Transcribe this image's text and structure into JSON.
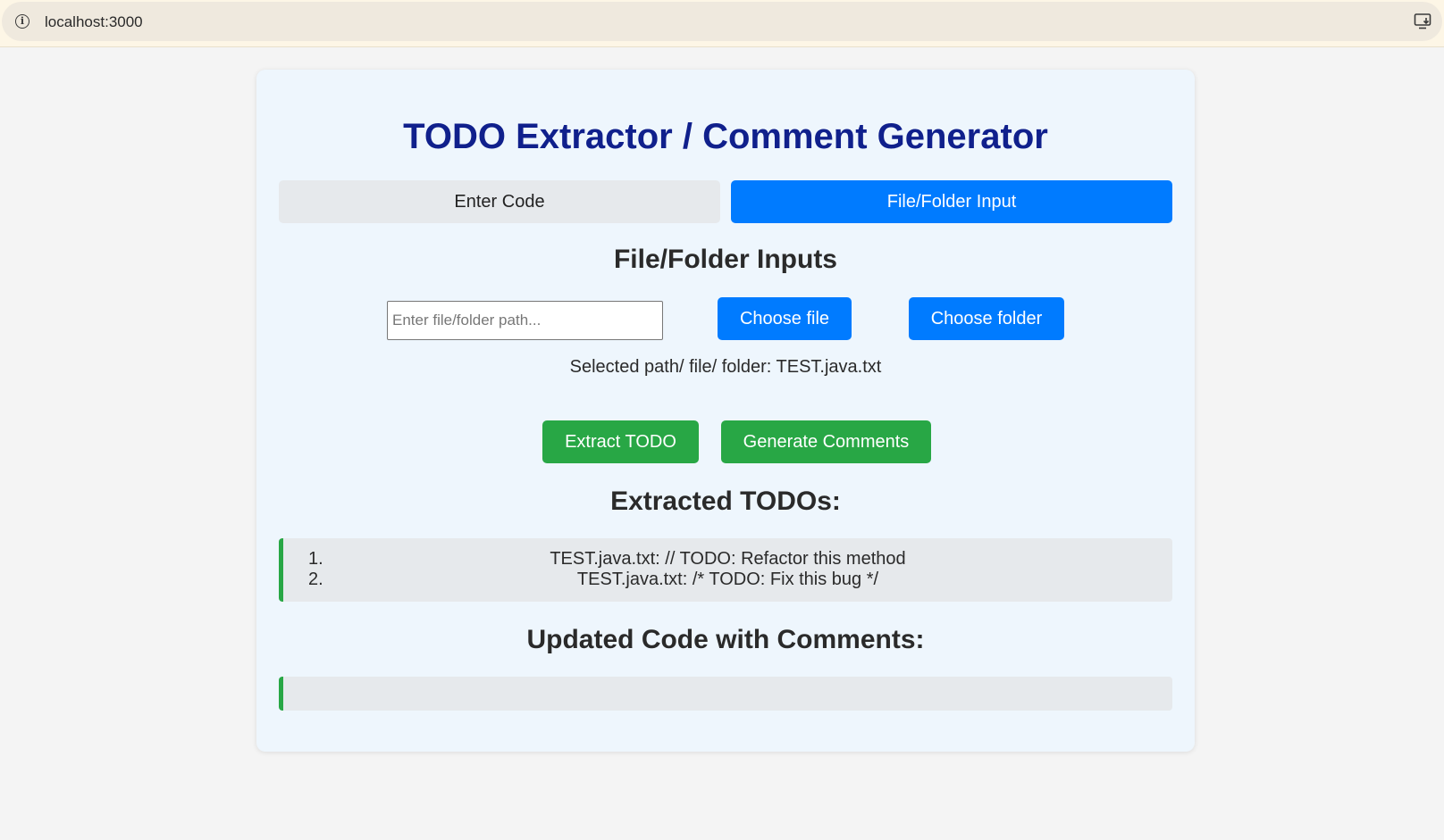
{
  "browser": {
    "url": "localhost:3000"
  },
  "app": {
    "title": "TODO Extractor / Comment Generator",
    "tabs": {
      "enter_code": "Enter Code",
      "file_folder": "File/Folder Input"
    },
    "file_section": {
      "heading": "File/Folder Inputs",
      "path_placeholder": "Enter file/folder path...",
      "path_value": "",
      "choose_file": "Choose file",
      "choose_folder": "Choose folder",
      "selected_path": "Selected path/ file/ folder: TEST.java.txt"
    },
    "actions": {
      "extract": "Extract TODO",
      "generate": "Generate Comments"
    },
    "todos": {
      "heading": "Extracted TODOs:",
      "items": [
        {
          "num": "1.",
          "text": "TEST.java.txt: // TODO: Refactor this method"
        },
        {
          "num": "2.",
          "text": "TEST.java.txt: /* TODO: Fix this bug */"
        }
      ]
    },
    "updated": {
      "heading": "Updated Code with Comments:",
      "content": ""
    }
  },
  "colors": {
    "title": "#10208c",
    "primary": "#007bff",
    "success": "#28a745",
    "card_bg": "#eef6fd"
  }
}
